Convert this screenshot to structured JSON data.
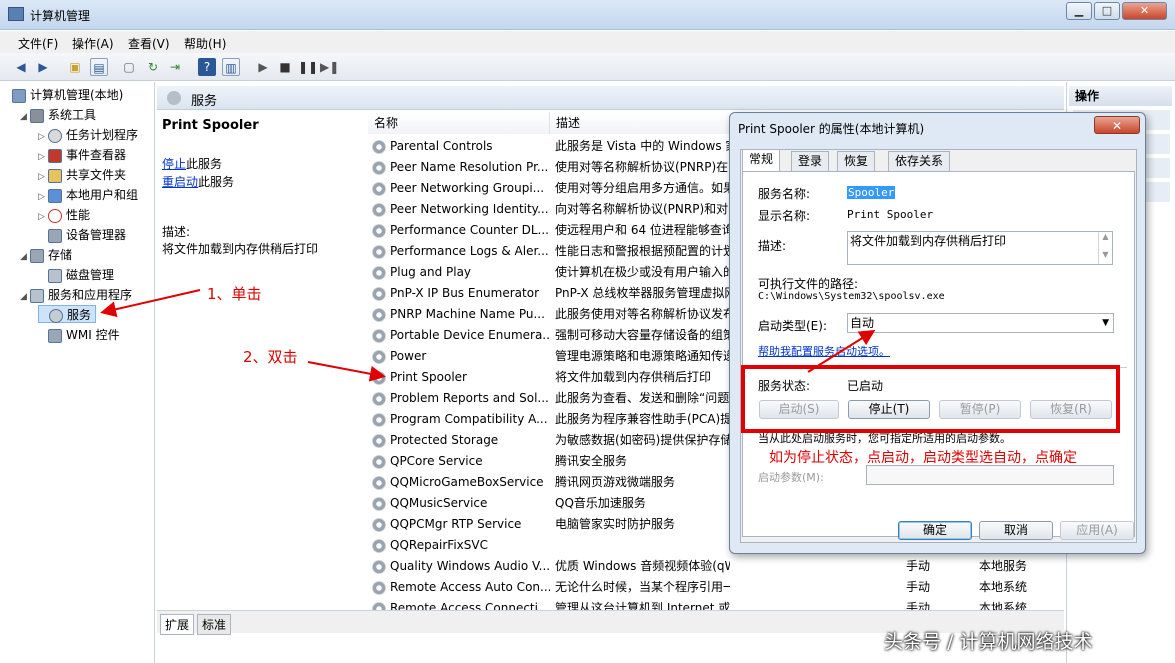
{
  "window": {
    "title": "计算机管理",
    "min": "▁",
    "max": "□",
    "close": "✕"
  },
  "menu": [
    "文件(F)",
    "操作(A)",
    "查看(V)",
    "帮助(H)"
  ],
  "tree": {
    "root": "计算机管理(本地)",
    "system_tools": "系统工具",
    "task_scheduler": "任务计划程序",
    "event_viewer": "事件查看器",
    "shared_folders": "共享文件夹",
    "local_users": "本地用户和组",
    "performance": "性能",
    "device_manager": "设备管理器",
    "storage": "存储",
    "disk_management": "磁盘管理",
    "services_apps": "服务和应用程序",
    "services": "服务",
    "wmi": "WMI 控件"
  },
  "header": {
    "title": "服务"
  },
  "desc_panel": {
    "service_name": "Print Spooler",
    "stop_link": "停止",
    "stop_suffix": "此服务",
    "restart_link": "重启动",
    "restart_suffix": "此服务",
    "desc_label": "描述:",
    "desc_text": "将文件加载到内存供稍后打印"
  },
  "list": {
    "col_name": "名称",
    "col_desc": "描述",
    "rows": [
      {
        "name": "Parental Controls",
        "desc": "此服务是 Vista 中的 Windows 家",
        "status": "",
        "logon": ""
      },
      {
        "name": "Peer Name Resolution Pr...",
        "desc": "使用对等名称解析协议(PNRP)在",
        "status": "",
        "logon": ""
      },
      {
        "name": "Peer Networking Groupi...",
        "desc": "使用对等分组启用多方通信。如果",
        "status": "",
        "logon": ""
      },
      {
        "name": "Peer Networking Identity...",
        "desc": "向对等名称解析协议(PNRP)和对",
        "status": "",
        "logon": ""
      },
      {
        "name": "Performance Counter DL...",
        "desc": "使远程用户和 64 位进程能够查询",
        "status": "",
        "logon": ""
      },
      {
        "name": "Performance Logs & Aler...",
        "desc": "性能日志和警报根据预配置的计划",
        "status": "",
        "logon": ""
      },
      {
        "name": "Plug and Play",
        "desc": "使计算机在极少或没有用户输入的",
        "status": "",
        "logon": ""
      },
      {
        "name": "PnP-X IP Bus Enumerator",
        "desc": "PnP-X 总线枚举器服务管理虚拟网",
        "status": "",
        "logon": ""
      },
      {
        "name": "PNRP Machine Name Pu...",
        "desc": "此服务使用对等名称解析协议发布",
        "status": "",
        "logon": ""
      },
      {
        "name": "Portable Device Enumera...",
        "desc": "强制可移动大容量存储设备的组策",
        "status": "",
        "logon": ""
      },
      {
        "name": "Power",
        "desc": "管理电源策略和电源策略通知传递",
        "status": "",
        "logon": ""
      },
      {
        "name": "Print Spooler",
        "desc": "将文件加载到内存供稍后打印",
        "status": "",
        "logon": ""
      },
      {
        "name": "Problem Reports and Sol...",
        "desc": "此服务为查看、发送和删除“问题",
        "status": "",
        "logon": ""
      },
      {
        "name": "Program Compatibility A...",
        "desc": "此服务为程序兼容性助手(PCA)提",
        "status": "",
        "logon": ""
      },
      {
        "name": "Protected Storage",
        "desc": "为敏感数据(如密码)提供保护存储",
        "status": "",
        "logon": ""
      },
      {
        "name": "QPCore Service",
        "desc": "腾讯安全服务",
        "status": "",
        "logon": ""
      },
      {
        "name": "QQMicroGameBoxService",
        "desc": "腾讯网页游戏微端服务",
        "status": "",
        "logon": ""
      },
      {
        "name": "QQMusicService",
        "desc": "QQ音乐加速服务",
        "status": "",
        "logon": ""
      },
      {
        "name": "QQPCMgr RTP Service",
        "desc": "电脑管家实时防护服务",
        "status": "",
        "logon": ""
      },
      {
        "name": "QQRepairFixSVC",
        "desc": "",
        "status": "",
        "logon": ""
      },
      {
        "name": "Quality Windows Audio V...",
        "desc": "优质 Windows 音频视频体验(qWave)...",
        "status": "手动",
        "logon": "本地服务"
      },
      {
        "name": "Remote Access Auto Con...",
        "desc": "无论什么时候，当某个程序引用一个远程...",
        "status": "手动",
        "logon": "本地系统"
      },
      {
        "name": "Remote Access Connecti...",
        "desc": "管理从这台计算机到 Internet 或其他远...",
        "status": "手动",
        "logon": "本地系统"
      }
    ]
  },
  "bottom_tabs": [
    "扩展",
    "标准"
  ],
  "actions": {
    "title": "操作"
  },
  "dialog": {
    "title": "Print Spooler 的属性(本地计算机)",
    "tabs": [
      "常规",
      "登录",
      "恢复",
      "依存关系"
    ],
    "service_name_label": "服务名称:",
    "service_name_value": "Spooler",
    "display_name_label": "显示名称:",
    "display_name_value": "Print Spooler",
    "desc_label": "描述:",
    "desc_value": "将文件加载到内存供稍后打印",
    "path_label": "可执行文件的路径:",
    "path_value": "C:\\Windows\\System32\\spoolsv.exe",
    "startup_label": "启动类型(E):",
    "startup_value": "自动",
    "help_link": "帮助我配置服务启动选项。",
    "status_label": "服务状态:",
    "status_value": "已启动",
    "btn_start": "启动(S)",
    "btn_stop": "停止(T)",
    "btn_pause": "暂停(P)",
    "btn_resume": "恢复(R)",
    "hint": "当从此处启动服务时，您可指定所适用的启动参数。",
    "params_label": "启动参数(M):",
    "btn_ok": "确定",
    "btn_cancel": "取消",
    "btn_apply": "应用(A)"
  },
  "annotations": {
    "step1": "1、单击",
    "step2": "2、双击",
    "note": "如为停止状态，点启动，启动类型选自动，点确定"
  },
  "watermark": "头条号 / 计算机网络技术",
  "colors": {
    "annotation": "#e00000",
    "link": "#0033cc",
    "selection": "#3399ff"
  }
}
